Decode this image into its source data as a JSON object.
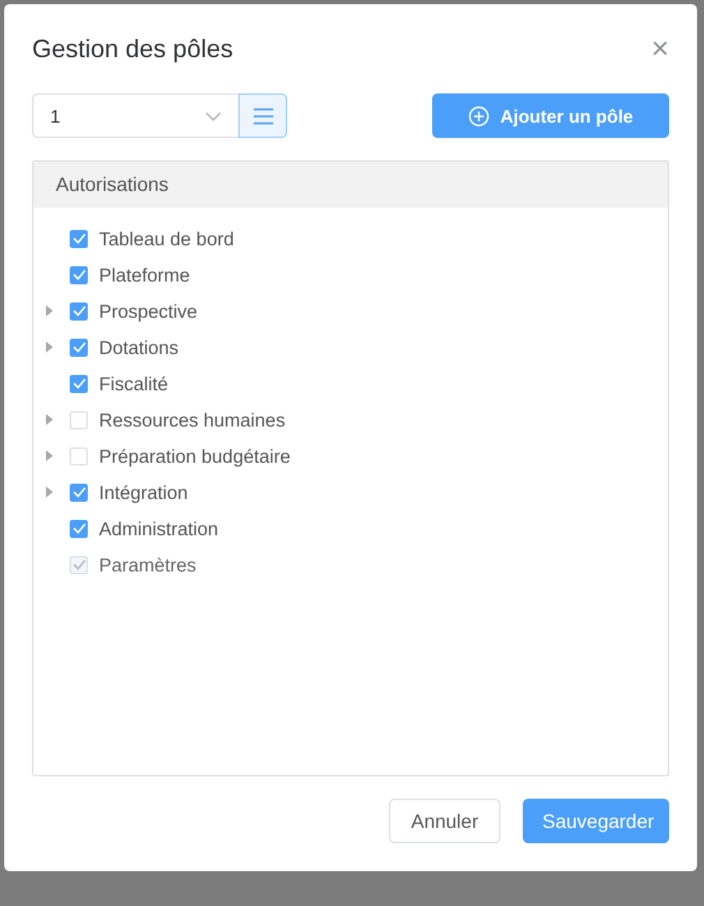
{
  "dialog": {
    "title": "Gestion des pôles",
    "close": "×"
  },
  "selector": {
    "value": "1"
  },
  "add_button": {
    "label": "Ajouter un pôle"
  },
  "panel": {
    "header": "Autorisations",
    "items": [
      {
        "label": "Tableau de bord",
        "checked": true,
        "disabled": false,
        "expandable": false
      },
      {
        "label": "Plateforme",
        "checked": true,
        "disabled": false,
        "expandable": false
      },
      {
        "label": "Prospective",
        "checked": true,
        "disabled": false,
        "expandable": true
      },
      {
        "label": "Dotations",
        "checked": true,
        "disabled": false,
        "expandable": true
      },
      {
        "label": "Fiscalité",
        "checked": true,
        "disabled": false,
        "expandable": false
      },
      {
        "label": "Ressources humaines",
        "checked": false,
        "disabled": false,
        "expandable": true
      },
      {
        "label": "Préparation budgétaire",
        "checked": false,
        "disabled": false,
        "expandable": true
      },
      {
        "label": "Intégration",
        "checked": true,
        "disabled": false,
        "expandable": true
      },
      {
        "label": "Administration",
        "checked": true,
        "disabled": false,
        "expandable": false
      },
      {
        "label": "Paramètres",
        "checked": true,
        "disabled": true,
        "expandable": false
      }
    ]
  },
  "footer": {
    "buttons": [
      {
        "label": "Annuler",
        "kind": "secondary"
      },
      {
        "label": "Sauvegarder",
        "kind": "primary"
      }
    ]
  }
}
